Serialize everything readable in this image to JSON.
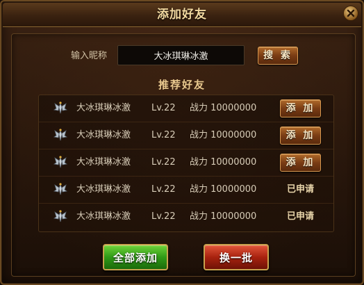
{
  "dialog": {
    "title": "添加好友",
    "close_icon": "close-icon"
  },
  "search": {
    "label": "输入昵称",
    "value": "大冰琪琳冰激",
    "button_label": "搜 索"
  },
  "recommend": {
    "title": "推荐好友",
    "rows": [
      {
        "icon": "rank-wings-icon",
        "name": "大冰琪琳冰激",
        "level": "Lv.22",
        "power": "战力 10000000",
        "action": "button",
        "action_label": "添 加"
      },
      {
        "icon": "rank-wings-icon",
        "name": "大冰琪琳冰激",
        "level": "Lv.22",
        "power": "战力 10000000",
        "action": "button",
        "action_label": "添 加"
      },
      {
        "icon": "rank-wings-icon",
        "name": "大冰琪琳冰激",
        "level": "Lv.22",
        "power": "战力 10000000",
        "action": "button",
        "action_label": "添 加"
      },
      {
        "icon": "rank-wings-icon",
        "name": "大冰琪琳冰激",
        "level": "Lv.22",
        "power": "战力 10000000",
        "action": "status",
        "action_label": "已申请"
      },
      {
        "icon": "rank-wings-icon",
        "name": "大冰琪琳冰激",
        "level": "Lv.22",
        "power": "战力 10000000",
        "action": "status",
        "action_label": "已申请"
      }
    ]
  },
  "footer": {
    "add_all_label": "全部添加",
    "refresh_label": "换一批"
  },
  "colors": {
    "title_gold": "#f2d9a0",
    "accent_green": "#2f9a17",
    "accent_red": "#a8220f",
    "button_brown": "#7a3c14"
  }
}
